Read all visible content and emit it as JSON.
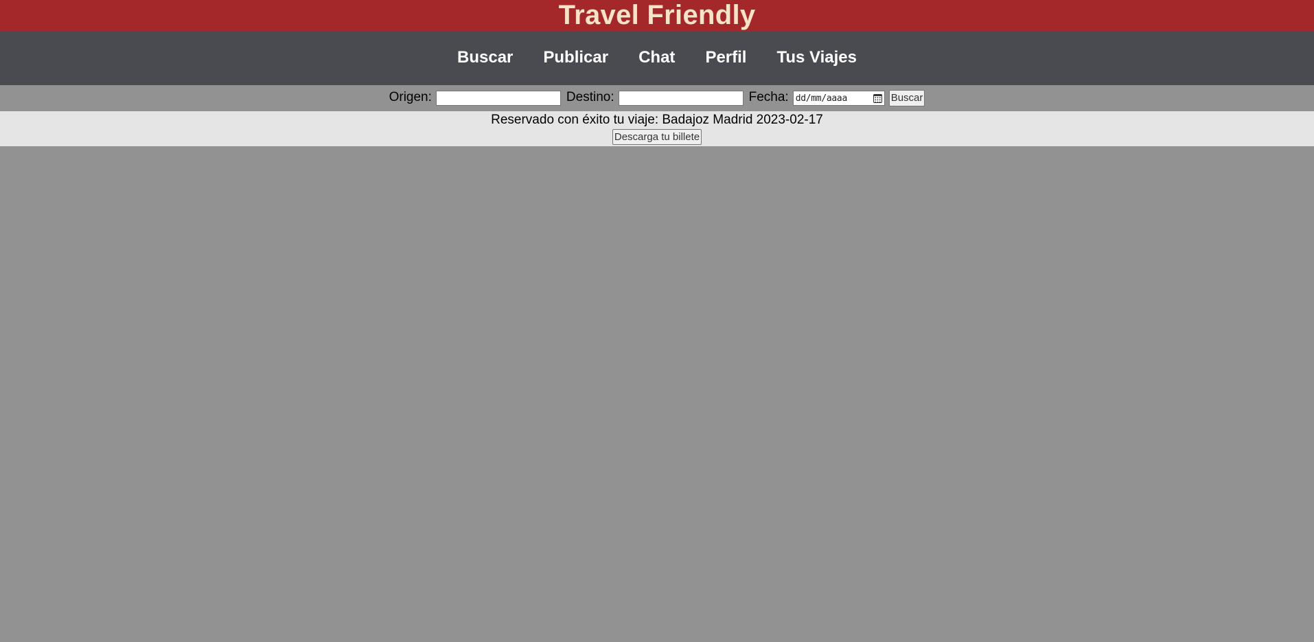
{
  "header": {
    "title": "Travel Friendly"
  },
  "nav": {
    "items": [
      {
        "label": "Buscar"
      },
      {
        "label": "Publicar"
      },
      {
        "label": "Chat"
      },
      {
        "label": "Perfil"
      },
      {
        "label": "Tus Viajes"
      }
    ]
  },
  "search": {
    "origin_label": "Origen:",
    "origin_value": "",
    "destination_label": "Destino:",
    "destination_value": "",
    "date_label": "Fecha:",
    "date_placeholder": "dd/mm/aaaa",
    "date_icon": "calendar-icon",
    "submit_label": "Buscar"
  },
  "notice": {
    "message": "Reservado con éxito tu viaje: Badajoz Madrid 2023-02-17",
    "download_label": "Descarga tu billete"
  },
  "colors": {
    "header_bg": "#a4282a",
    "header_text": "#f6e3c8",
    "nav_bg": "#4a4b50",
    "page_bg": "#929292",
    "notice_bg": "#e5e5e5"
  }
}
